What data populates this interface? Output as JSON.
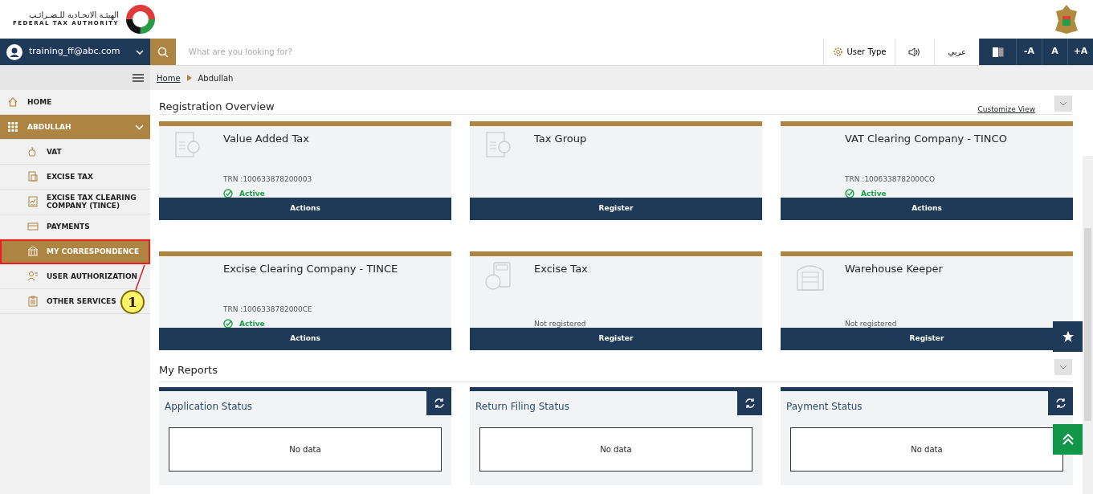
{
  "header": {
    "logo_arabic": "الهيئـة الاتحـادية للـضـرائـب",
    "logo_english": "FEDERAL TAX AUTHORITY"
  },
  "topbar": {
    "user": "training_ff@abc.com",
    "search": {
      "placeholder": "What are you looking for?"
    },
    "user_type": "User Type",
    "language": "عربي",
    "font_buttons": [
      "-A",
      "A",
      "+A"
    ]
  },
  "breadcrumb": [
    "Home",
    "Abdullah"
  ],
  "sidebar": {
    "items": [
      {
        "label": "HOME",
        "selected": false
      },
      {
        "label": "ABDULLAH",
        "selected": true,
        "expanded": true,
        "children": [
          {
            "label": "VAT",
            "selected": false,
            "highlighted": false
          },
          {
            "label": "EXCISE TAX",
            "selected": false,
            "highlighted": false
          },
          {
            "label": "EXCISE TAX CLEARING COMPANY (TINCE)",
            "selected": false,
            "highlighted": false
          },
          {
            "label": "PAYMENTS",
            "selected": false,
            "highlighted": false
          },
          {
            "label": "MY CORRESPONDENCE",
            "selected": true,
            "highlighted": true
          },
          {
            "label": "USER AUTHORIZATION",
            "selected": false,
            "highlighted": false
          },
          {
            "label": "OTHER SERVICES",
            "selected": false,
            "highlighted": false
          }
        ]
      }
    ]
  },
  "callout": {
    "number": "1"
  },
  "registration": {
    "title": "Registration Overview",
    "customize": "Customize View",
    "cards": [
      {
        "title": "Value Added Tax",
        "trn": "TRN :100633878200003",
        "status": "Active",
        "kind": "active",
        "button": "Actions"
      },
      {
        "title": "Tax Group",
        "kind": "empty",
        "button": "Register"
      },
      {
        "title": "VAT Clearing Company - TINCO",
        "trn": "TRN :1006338782000CO",
        "status": "Active",
        "kind": "active",
        "button": "Actions"
      },
      {
        "title": "Excise Clearing Company - TINCE",
        "trn": "TRN :1006338782000CE",
        "status": "Active",
        "kind": "active",
        "button": "Actions"
      },
      {
        "title": "Excise Tax",
        "status": "Not registered",
        "kind": "unregistered",
        "button": "Register"
      },
      {
        "title": "Warehouse Keeper",
        "status": "Not registered",
        "kind": "unregistered",
        "button": "Register"
      }
    ]
  },
  "reports": {
    "title": "My Reports",
    "cards": [
      {
        "title": "Application Status",
        "message": "No data"
      },
      {
        "title": "Return Filing Status",
        "message": "No data"
      },
      {
        "title": "Payment Status",
        "message": "No data"
      }
    ]
  }
}
